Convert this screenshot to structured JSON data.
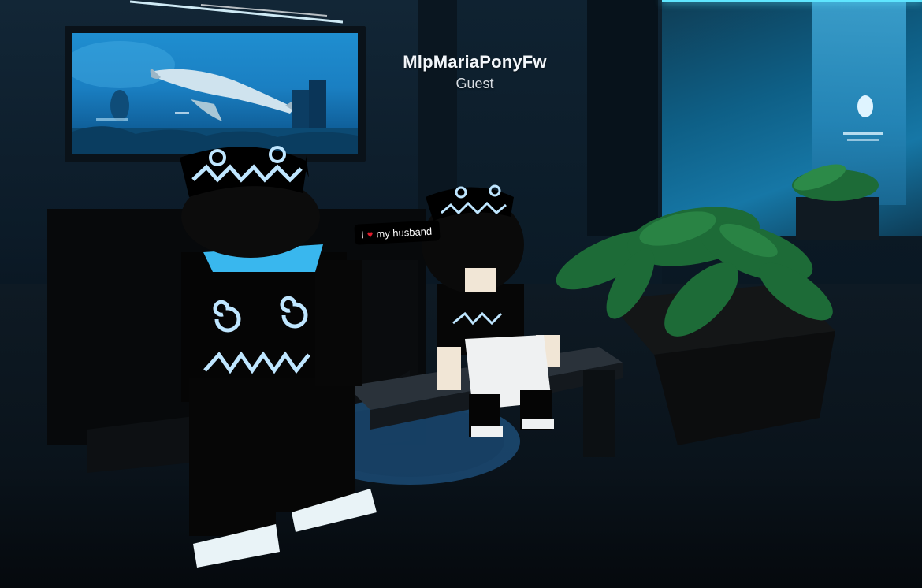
{
  "nametag": {
    "username": "MlpMariaPonyFw",
    "role": "Guest"
  },
  "chat_bubble": {
    "icon": "heart-icon",
    "prefix": "I",
    "text": "my husband"
  },
  "colors": {
    "aquarium_water": "#1a7fc2",
    "neon_accent": "#5fe6ff",
    "heart": "#e11b2b",
    "outfit": "#050505",
    "outfit_print": "#bfe6ff"
  }
}
